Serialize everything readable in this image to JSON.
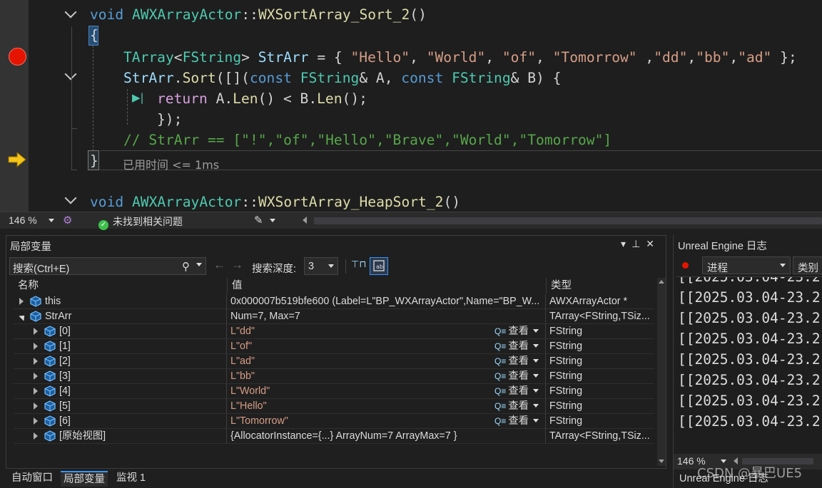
{
  "editor": {
    "line1": {
      "kw": "void",
      "cls": "AWXArrayActor",
      "sep": "::",
      "fn": "WXSortArray_Sort_2",
      "paren": "()"
    },
    "line2": "{",
    "line3": {
      "type": "TArray",
      "lt": "<",
      "inner": "FString",
      "gt": ">",
      "var": "StrArr",
      "eq": " = { ",
      "s1": "\"Hello\"",
      "s2": "\"World\"",
      "s3": "\"of\"",
      "s4": "\"Tomorrow\"",
      "s5": "\"dd\"",
      "s6": "\"bb\"",
      "s7": "\"ad\"",
      "end": " };"
    },
    "line4": {
      "var": "StrArr",
      "dot": ".",
      "fn": "Sort",
      "open": "([](",
      "kw1": "const",
      "t1": "FString",
      "a": "& A, ",
      "kw2": "const",
      "t2": "FString",
      "b": "& B) {"
    },
    "line5": {
      "kw": "return",
      "a": "A",
      "len1": "Len",
      "mid": "() < ",
      "b": "B",
      "len2": "Len",
      "end": "();"
    },
    "line6": "});",
    "line7": "// StrArr == [\"!\",\"of\",\"Hello\",\"Brave\",\"World\",\"Tomorrow\"]",
    "line8": "}",
    "elapsed": "已用时间 <= 1ms",
    "line10": {
      "kw": "void",
      "cls": "AWXArrayActor",
      "sep": "::",
      "fn": "WXSortArray_HeapSort_2",
      "paren": "()"
    }
  },
  "status": {
    "zoom": "146 %",
    "issues": "未找到相关问题"
  },
  "locals": {
    "title": "局部变量",
    "search_placeholder": "搜索(Ctrl+E)",
    "depth_label": "搜索深度:",
    "depth_value": "3",
    "columns": {
      "name": "名称",
      "value": "值",
      "type": "类型"
    },
    "rows": [
      {
        "name": "this",
        "value": "0x000007b519bfe600 (Label=L\"BP_WXArrayActor\",Name=\"BP_W...",
        "type": "AWXArrayActor *",
        "level": 0,
        "str": false,
        "view": ""
      },
      {
        "name": "StrArr",
        "value": "Num=7, Max=7",
        "type": "TArray<FString,TSiz...",
        "level": 0,
        "str": false,
        "view": ""
      },
      {
        "name": "[0]",
        "value": "L\"dd\"",
        "type": "FString",
        "level": 1,
        "str": true,
        "view": "查看"
      },
      {
        "name": "[1]",
        "value": "L\"of\"",
        "type": "FString",
        "level": 1,
        "str": true,
        "view": "查看"
      },
      {
        "name": "[2]",
        "value": "L\"ad\"",
        "type": "FString",
        "level": 1,
        "str": true,
        "view": "查看"
      },
      {
        "name": "[3]",
        "value": "L\"bb\"",
        "type": "FString",
        "level": 1,
        "str": true,
        "view": "查看"
      },
      {
        "name": "[4]",
        "value": "L\"World\"",
        "type": "FString",
        "level": 1,
        "str": true,
        "view": "查看"
      },
      {
        "name": "[5]",
        "value": "L\"Hello\"",
        "type": "FString",
        "level": 1,
        "str": true,
        "view": "查看"
      },
      {
        "name": "[6]",
        "value": "L\"Tomorrow\"",
        "type": "FString",
        "level": 1,
        "str": true,
        "view": "查看"
      },
      {
        "name": "[原始视图]",
        "value": "{AllocatorInstance={...} ArrayNum=7 ArrayMax=7 }",
        "type": "TArray<FString,TSiz...",
        "level": 1,
        "str": false,
        "view": ""
      }
    ]
  },
  "tabs": [
    "自动窗口",
    "局部变量",
    "监视 1"
  ],
  "ue": {
    "title": "Unreal Engine 日志",
    "process": "进程",
    "category": "类别",
    "lines": [
      "[[2025.03.04-23.2",
      "[[2025.03.04-23.2",
      "[[2025.03.04-23.2",
      "[[2025.03.04-23.2",
      "[[2025.03.04-23.2",
      "[[2025.03.04-23.2",
      "[[2025.03.04-23.2",
      "[[2025.03.04-23.2"
    ],
    "zoom": "146 %",
    "tab": "Unreal Engine 日志"
  },
  "watermark": "CSDN @暴巴UE5",
  "colors": {
    "accent": "#3794ff",
    "breakpoint": "#e51400",
    "string": "#d69d85",
    "keyword": "#569cd6"
  }
}
